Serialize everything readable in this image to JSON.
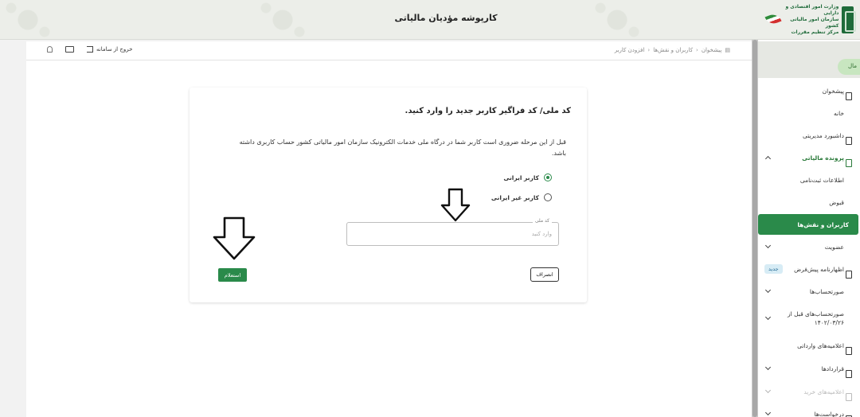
{
  "header": {
    "title": "کارپوشه مؤدیان مالیاتی",
    "logo_lines": [
      "وزارت امور اقتصادی و دارایی",
      "سازمان امور مالیاتی کشور",
      "مرکز تنظیم مقررات"
    ]
  },
  "toolbar": {
    "breadcrumb": [
      "پیشخوان",
      "کاربران و نقش‌ها",
      "افزودن کاربر"
    ],
    "exit_label": "خروج از سامانه"
  },
  "sidebar": {
    "chip": "مال",
    "items": [
      {
        "label": "پیشخوان"
      },
      {
        "label": "خانه"
      },
      {
        "label": "داشبورد مدیریتی"
      },
      {
        "label": "پرونده مالیاتی"
      },
      {
        "label": "اطلاعات ثبت‌نامی"
      },
      {
        "label": "قبوض"
      },
      {
        "label": "کاربران و نقش‌ها"
      },
      {
        "label": "عضویت"
      },
      {
        "label": "اظهارنامه پیش‌فرض",
        "badge": "جدید"
      },
      {
        "label": "صورتحساب‌ها"
      },
      {
        "label": "صورتحساب‌های قبل از ۱۴۰۲/۰۳/۲۶"
      },
      {
        "label": "اعلامیه‌های وارداتی"
      },
      {
        "label": "قراردادها"
      },
      {
        "label": "اعلامیه‌های خرید"
      },
      {
        "label": "درخواست‌ها"
      }
    ]
  },
  "form": {
    "title": "کد ملی/ کد فراگیر کاربر جدید را وارد کنید.",
    "description": "قبل از این مرحله ضروری است کاربر شما در درگاه ملی خدمات الکترونیک سازمان امور مالیاتی کشور حساب کاربری داشته باشد.",
    "radio_iranian": "کاربر ایرانی",
    "radio_foreign": "کاربر غیر ایرانی",
    "selected": "iranian",
    "field_label": "کد ملی",
    "field_placeholder": "وارد کنید",
    "field_value": "",
    "cancel_label": "انصراف",
    "confirm_label": "استعلام"
  },
  "colors": {
    "accent": "#2a8a4a",
    "header_bg": "#eceee9",
    "badge_bg": "#d7ecf5"
  }
}
